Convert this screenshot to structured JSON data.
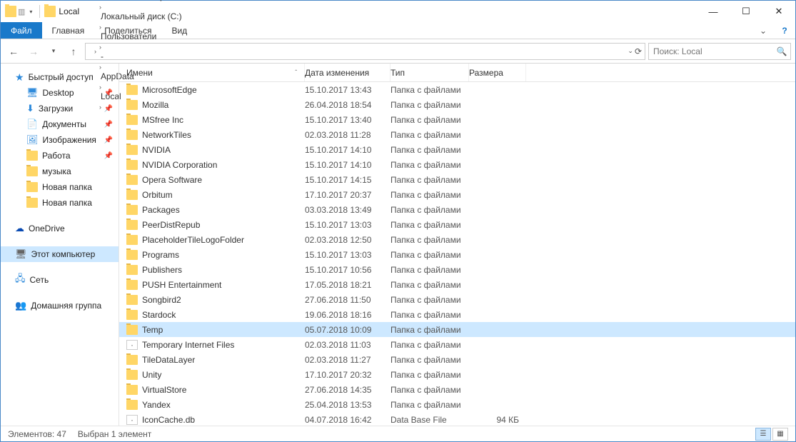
{
  "title": "Local",
  "ribbon": {
    "file": "Файл",
    "tabs": [
      "Главная",
      "Поделиться",
      "Вид"
    ]
  },
  "breadcrumb": [
    "Этот компьютер",
    "Локальный диск (C:)",
    "Пользователи",
    "-",
    "AppData",
    "Local"
  ],
  "search": {
    "placeholder": "Поиск: Local"
  },
  "sidebar": {
    "quick": {
      "label": "Быстрый доступ",
      "icon": "star"
    },
    "quick_items": [
      {
        "label": "Desktop",
        "icon": "desktop",
        "pinned": true
      },
      {
        "label": "Загрузки",
        "icon": "download",
        "pinned": true
      },
      {
        "label": "Документы",
        "icon": "doc",
        "pinned": true
      },
      {
        "label": "Изображения",
        "icon": "pic",
        "pinned": true
      },
      {
        "label": "Работа",
        "icon": "folder",
        "pinned": true
      },
      {
        "label": "музыка",
        "icon": "folder",
        "pinned": false
      },
      {
        "label": "Новая папка",
        "icon": "folder",
        "pinned": false
      },
      {
        "label": "Новая папка",
        "icon": "folder",
        "pinned": false
      }
    ],
    "onedrive": "OneDrive",
    "thispc": "Этот компьютер",
    "network": "Сеть",
    "homegroup": "Домашняя группа"
  },
  "columns": {
    "name": "Имени",
    "date": "Дата изменения",
    "type": "Тип",
    "size": "Размера"
  },
  "folder_type": "Папка с файлами",
  "files": [
    {
      "name": "MicrosoftEdge",
      "date": "15.10.2017 13:43",
      "type": "Папка с файлами",
      "size": "",
      "icon": "folder"
    },
    {
      "name": "Mozilla",
      "date": "26.04.2018 18:54",
      "type": "Папка с файлами",
      "size": "",
      "icon": "folder"
    },
    {
      "name": "MSfree Inc",
      "date": "15.10.2017 13:40",
      "type": "Папка с файлами",
      "size": "",
      "icon": "folder"
    },
    {
      "name": "NetworkTiles",
      "date": "02.03.2018 11:28",
      "type": "Папка с файлами",
      "size": "",
      "icon": "folder"
    },
    {
      "name": "NVIDIA",
      "date": "15.10.2017 14:10",
      "type": "Папка с файлами",
      "size": "",
      "icon": "folder"
    },
    {
      "name": "NVIDIA Corporation",
      "date": "15.10.2017 14:10",
      "type": "Папка с файлами",
      "size": "",
      "icon": "folder"
    },
    {
      "name": "Opera Software",
      "date": "15.10.2017 14:15",
      "type": "Папка с файлами",
      "size": "",
      "icon": "folder"
    },
    {
      "name": "Orbitum",
      "date": "17.10.2017 20:37",
      "type": "Папка с файлами",
      "size": "",
      "icon": "folder"
    },
    {
      "name": "Packages",
      "date": "03.03.2018 13:49",
      "type": "Папка с файлами",
      "size": "",
      "icon": "folder"
    },
    {
      "name": "PeerDistRepub",
      "date": "15.10.2017 13:03",
      "type": "Папка с файлами",
      "size": "",
      "icon": "folder"
    },
    {
      "name": "PlaceholderTileLogoFolder",
      "date": "02.03.2018 12:50",
      "type": "Папка с файлами",
      "size": "",
      "icon": "folder"
    },
    {
      "name": "Programs",
      "date": "15.10.2017 13:03",
      "type": "Папка с файлами",
      "size": "",
      "icon": "folder"
    },
    {
      "name": "Publishers",
      "date": "15.10.2017 10:56",
      "type": "Папка с файлами",
      "size": "",
      "icon": "folder"
    },
    {
      "name": "PUSH Entertainment",
      "date": "17.05.2018 18:21",
      "type": "Папка с файлами",
      "size": "",
      "icon": "folder"
    },
    {
      "name": "Songbird2",
      "date": "27.06.2018 11:50",
      "type": "Папка с файлами",
      "size": "",
      "icon": "folder"
    },
    {
      "name": "Stardock",
      "date": "19.06.2018 18:16",
      "type": "Папка с файлами",
      "size": "",
      "icon": "folder"
    },
    {
      "name": "Temp",
      "date": "05.07.2018 10:09",
      "type": "Папка с файлами",
      "size": "",
      "icon": "folder",
      "selected": true
    },
    {
      "name": "Temporary Internet Files",
      "date": "02.03.2018 11:03",
      "type": "Папка с файлами",
      "size": "",
      "icon": "generic"
    },
    {
      "name": "TileDataLayer",
      "date": "02.03.2018 11:27",
      "type": "Папка с файлами",
      "size": "",
      "icon": "folder"
    },
    {
      "name": "Unity",
      "date": "17.10.2017 20:32",
      "type": "Папка с файлами",
      "size": "",
      "icon": "folder"
    },
    {
      "name": "VirtualStore",
      "date": "27.06.2018 14:35",
      "type": "Папка с файлами",
      "size": "",
      "icon": "folder"
    },
    {
      "name": "Yandex",
      "date": "25.04.2018 13:53",
      "type": "Папка с файлами",
      "size": "",
      "icon": "folder"
    },
    {
      "name": "IconCache.db",
      "date": "04.07.2018 16:42",
      "type": "Data Base File",
      "size": "94 КБ",
      "icon": "generic"
    }
  ],
  "status": {
    "items": "Элементов: 47",
    "selected": "Выбран 1 элемент"
  }
}
